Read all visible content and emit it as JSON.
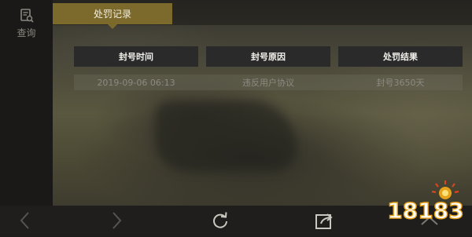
{
  "sidebar": {
    "items": [
      {
        "label": "查询",
        "icon": "document-search-icon"
      }
    ]
  },
  "tabs": [
    {
      "label": "处罚记录",
      "active": true
    }
  ],
  "table": {
    "columns": [
      "封号时间",
      "封号原因",
      "处罚结果"
    ],
    "rows": [
      [
        "2019-09-06 06:13",
        "违反用户协议",
        "封号3650天"
      ]
    ]
  },
  "bottom_nav": {
    "buttons": [
      "back-arrow-icon",
      "forward-arrow-icon",
      "refresh-icon",
      "share-icon",
      "collapse-up-icon"
    ]
  },
  "watermark": {
    "text": "18183"
  },
  "colors": {
    "accent": "#7c6a2c",
    "header_bg": "#2a2a2b",
    "sidebar_bg": "#1a1917",
    "bottom_bar_bg": "#1f1e1c"
  }
}
